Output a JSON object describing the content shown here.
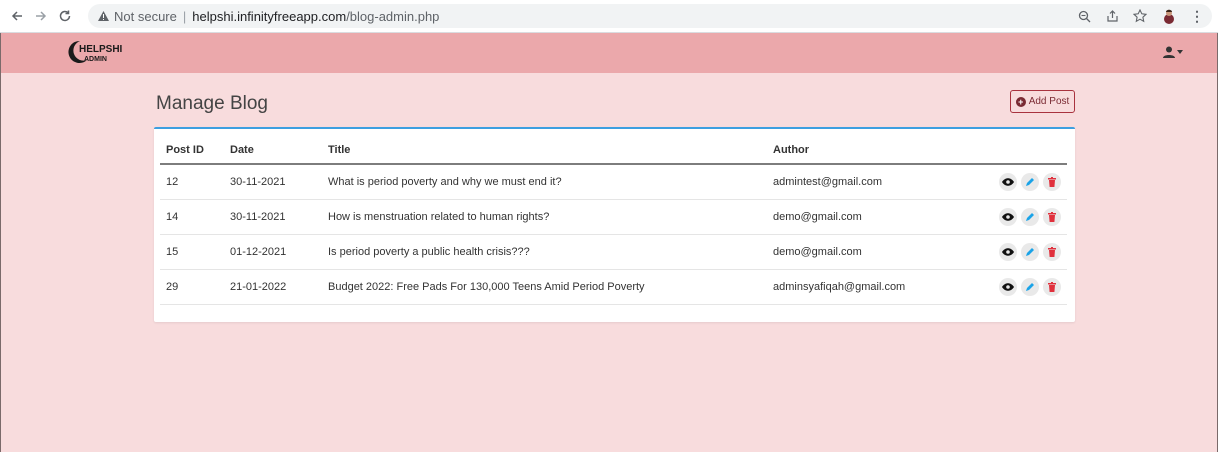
{
  "browser": {
    "not_secure": "Not secure",
    "separator": "|",
    "host": "helpshi.infinityfreeapp.com",
    "path": "/blog-admin.php"
  },
  "logo": {
    "line1": "HELPSHI",
    "line2": "ADMIN"
  },
  "page": {
    "title": "Manage Blog",
    "add_label": "Add Post"
  },
  "table": {
    "headers": [
      "Post ID",
      "Date",
      "Title",
      "Author"
    ],
    "rows": [
      {
        "id": "12",
        "date": "30-11-2021",
        "title": "What is period poverty and why we must end it?",
        "author": "admintest@gmail.com"
      },
      {
        "id": "14",
        "date": "30-11-2021",
        "title": "How is menstruation related to human rights?",
        "author": "demo@gmail.com"
      },
      {
        "id": "15",
        "date": "01-12-2021",
        "title": "Is period poverty a public health crisis???",
        "author": "demo@gmail.com"
      },
      {
        "id": "29",
        "date": "21-01-2022",
        "title": "Budget 2022: Free Pads For 130,000 Teens Amid Period Poverty",
        "author": "adminsyafiqah@gmail.com"
      }
    ]
  },
  "colors": {
    "page_bg": "#f8dcdd",
    "navbar_bg": "#eba8ab",
    "card_border": "#3d9fe0",
    "edit": "#1aa3e8",
    "delete": "#e0303c"
  },
  "icons": [
    "back-icon",
    "forward-icon",
    "reload-icon",
    "warning-icon",
    "zoom-icon",
    "share-icon",
    "star-icon",
    "kebab-icon",
    "user-icon",
    "eye-icon",
    "pencil-icon",
    "trash-icon"
  ]
}
